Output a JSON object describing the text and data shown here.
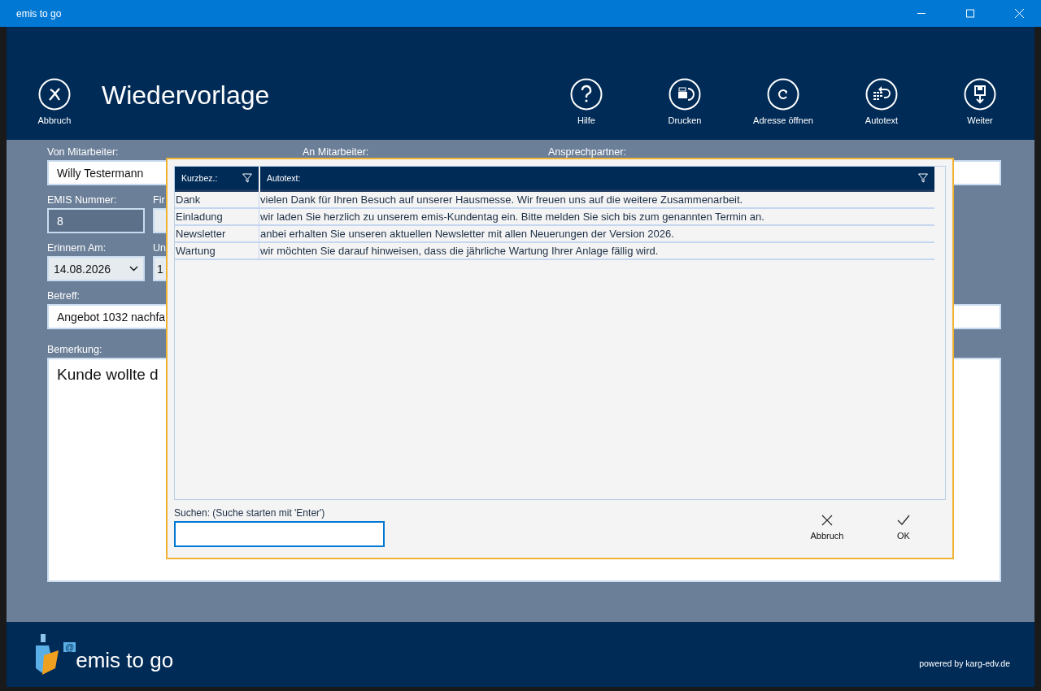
{
  "window": {
    "title": "emis to go"
  },
  "header": {
    "cancel": {
      "label": "Abbruch"
    },
    "title": "Wiedervorlage",
    "actions": [
      {
        "label": "Hilfe"
      },
      {
        "label": "Drucken"
      },
      {
        "label": "Adresse öffnen"
      },
      {
        "label": "Autotext"
      },
      {
        "label": "Weiter"
      }
    ]
  },
  "form": {
    "von": {
      "label": "Von Mitarbeiter:",
      "value": "Willy Testermann"
    },
    "an": {
      "label": "An Mitarbeiter:"
    },
    "ansprechpartner": {
      "label": "Ansprechpartner:"
    },
    "emis": {
      "label": "EMIS Nummer:",
      "value": "8",
      "disabled": true
    },
    "firma": {
      "label": "Fir"
    },
    "erinnern": {
      "label": "Erinnern Am:",
      "value": "14.08.2026"
    },
    "um": {
      "label": "Un",
      "value": "1"
    },
    "betreff": {
      "label": "Betreff:",
      "value": "Angebot 1032 nachfa"
    },
    "bemerkung": {
      "label": "Bemerkung:",
      "value": "Kunde wollte d"
    }
  },
  "dialog": {
    "columns": [
      {
        "label": "Kurzbez.:",
        "filter": true
      },
      {
        "label": "Autotext:",
        "filter": true
      }
    ],
    "rows": [
      {
        "kurzbez": "Dank",
        "autotext": "vielen Dank für Ihren Besuch auf unserer Hausmesse. Wir freuen uns auf die weitere Zusammenarbeit."
      },
      {
        "kurzbez": "Einladung",
        "autotext": "wir laden Sie herzlich zu unserem emis-Kundentag ein. Bitte melden Sie sich bis zum genannten Termin an."
      },
      {
        "kurzbez": "Newsletter",
        "autotext": "anbei erhalten Sie unseren aktuellen Newsletter mit allen Neuerungen der Version 2026."
      },
      {
        "kurzbez": "Wartung",
        "autotext": "wir möchten Sie darauf hinweisen, dass die jährliche Wartung Ihrer Anlage fällig wird."
      }
    ],
    "search": {
      "label": "Suchen: (Suche starten mit 'Enter')"
    },
    "buttons": [
      {
        "label": "Abbruch",
        "kind": "cancel"
      },
      {
        "label": "OK",
        "kind": "ok"
      }
    ]
  },
  "footer": {
    "logo_mark": "@",
    "app_name": "emis to go",
    "powered": "powered by karg-edv.de"
  }
}
